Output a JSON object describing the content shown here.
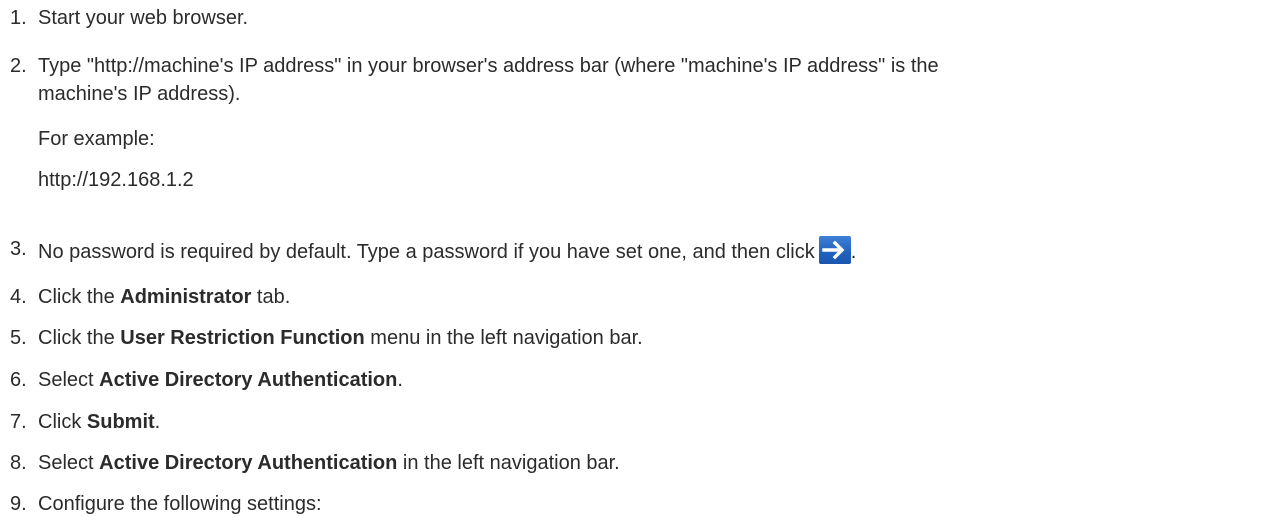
{
  "steps": [
    {
      "num": "1.",
      "text": "Start your web browser."
    },
    {
      "num": "2.",
      "line1": "Type \"http://machine's IP address\" in your browser's address bar (where \"machine's IP address\" is the",
      "line2": "machine's IP address).",
      "example_label": "For example:",
      "example_url": "http://192.168.1.2"
    },
    {
      "num": "3.",
      "text": "No password is required by default. Type a password if you have set one, and then click",
      "icon": "right-arrow-login-icon",
      "trailing": "."
    },
    {
      "num": "4.",
      "pre": "Click the ",
      "bold": "Administrator",
      "post": " tab."
    },
    {
      "num": "5.",
      "pre": "Click the ",
      "bold": "User Restriction Function",
      "post": " menu in the left navigation bar."
    },
    {
      "num": "6.",
      "pre": "Select ",
      "bold": "Active Directory Authentication",
      "post": "."
    },
    {
      "num": "7.",
      "pre": "Click ",
      "bold": "Submit",
      "post": "."
    },
    {
      "num": "8.",
      "pre": "Select ",
      "bold": "Active Directory Authentication",
      "post": " in the left navigation bar."
    },
    {
      "num": "9.",
      "text": "Configure the following settings:"
    }
  ],
  "colors": {
    "text": "#2b2b2b",
    "button_blue": "#2364bf",
    "arrow": "#ffffff"
  }
}
